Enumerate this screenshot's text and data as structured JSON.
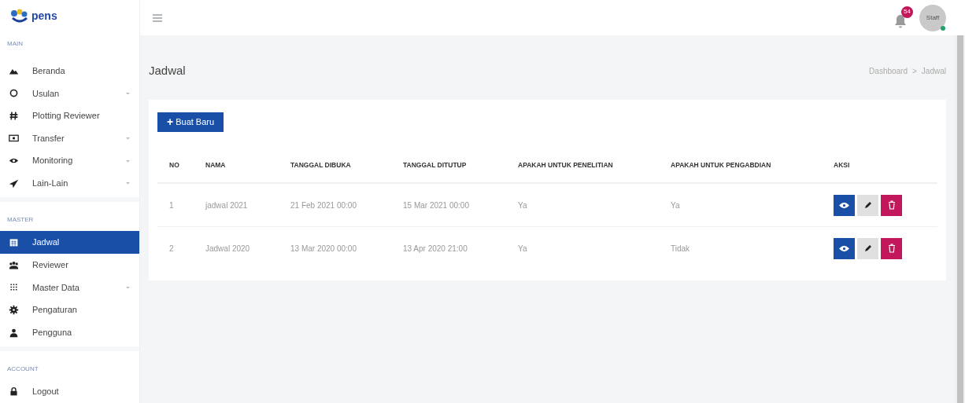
{
  "logo": {
    "text": "pens"
  },
  "topbar": {
    "notification_count": "54",
    "avatar": {
      "initials": "Staff",
      "online": true
    }
  },
  "sidebar": {
    "sections": [
      {
        "title": "MAIN",
        "items": [
          {
            "label": "Beranda",
            "expandable": false,
            "selected": false
          },
          {
            "label": "Usulan",
            "expandable": true,
            "selected": false
          },
          {
            "label": "Plotting Reviewer",
            "expandable": false,
            "selected": false
          },
          {
            "label": "Transfer",
            "expandable": true,
            "selected": false
          },
          {
            "label": "Monitoring",
            "expandable": true,
            "selected": false
          },
          {
            "label": "Lain-Lain",
            "expandable": true,
            "selected": false
          }
        ]
      },
      {
        "title": "MASTER",
        "items": [
          {
            "label": "Jadwal",
            "expandable": false,
            "selected": true
          },
          {
            "label": "Reviewer",
            "expandable": false,
            "selected": false
          },
          {
            "label": "Master Data",
            "expandable": true,
            "selected": false
          },
          {
            "label": "Pengaturan",
            "expandable": false,
            "selected": false
          },
          {
            "label": "Pengguna",
            "expandable": false,
            "selected": false
          }
        ]
      },
      {
        "title": "ACCOUNT",
        "items": [
          {
            "label": "Logout",
            "expandable": false,
            "selected": false
          }
        ]
      }
    ]
  },
  "page": {
    "title": "Jadwal",
    "breadcrumb": [
      "Dashboard",
      "Jadwal"
    ],
    "breadcrumb_separator": ">"
  },
  "new_button": {
    "icon": "+",
    "label": "Buat Baru"
  },
  "table": {
    "columns": [
      "NO",
      "NAMA",
      "TANGGAL DIBUKA",
      "TANGGAL DITUTUP",
      "APAKAH UNTUK PENELITIAN",
      "APAKAH UNTUK PENGABDIAN",
      "AKSI"
    ],
    "rows": [
      {
        "cells": [
          "1",
          "jadwal 2021",
          "21 Feb 2021 00:00",
          "15 Mar 2021 00:00",
          "Ya",
          "Ya"
        ]
      },
      {
        "cells": [
          "2",
          "Jadwal 2020",
          "13 Mar 2020 00:00",
          "13 Apr 2020 21:00",
          "Ya",
          "Tidak"
        ]
      }
    ]
  }
}
